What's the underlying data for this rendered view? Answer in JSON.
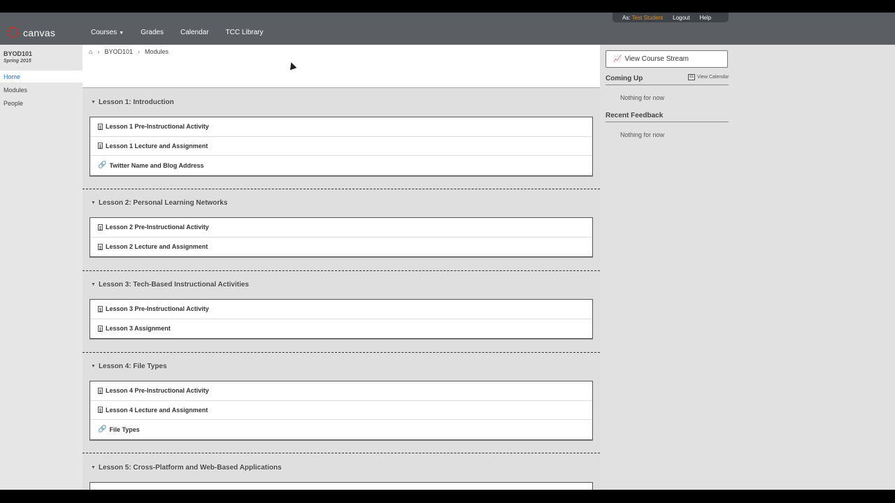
{
  "header": {
    "user_bar": {
      "as_label": "As:",
      "student": "Test Student",
      "logout": "Logout",
      "help": "Help"
    },
    "logo_text": "canvas",
    "nav": {
      "courses": "Courses",
      "grades": "Grades",
      "calendar": "Calendar",
      "library": "TCC Library"
    }
  },
  "course": {
    "id": "BYOD101",
    "term": "Spring 2015",
    "nav": [
      "Home",
      "Modules",
      "People"
    ]
  },
  "breadcrumb": {
    "course": "BYOD101",
    "page": "Modules"
  },
  "modules": [
    {
      "title": "Lesson 1: Introduction",
      "items": [
        {
          "label": "Lesson 1 Pre-Instructional Activity",
          "icon": "page-icon"
        },
        {
          "label": "Lesson 1 Lecture and Assignment",
          "icon": "page-icon"
        },
        {
          "label": "Twitter Name and Blog Address",
          "icon": "link-icon"
        }
      ]
    },
    {
      "title": "Lesson 2: Personal Learning Networks",
      "items": [
        {
          "label": "Lesson 2 Pre-Instructional Activity",
          "icon": "page-icon"
        },
        {
          "label": "Lesson 2 Lecture and Assignment",
          "icon": "page-icon"
        }
      ]
    },
    {
      "title": "Lesson 3: Tech-Based Instructional Activities",
      "items": [
        {
          "label": "Lesson 3 Pre-Instructional Activity",
          "icon": "page-icon"
        },
        {
          "label": "Lesson 3 Assignment",
          "icon": "page-icon"
        }
      ]
    },
    {
      "title": "Lesson 4: File Types",
      "items": [
        {
          "label": "Lesson 4 Pre-Instructional Activity",
          "icon": "page-icon"
        },
        {
          "label": "Lesson 4 Lecture and Assignment",
          "icon": "page-icon"
        },
        {
          "label": "File Types",
          "icon": "link-icon"
        }
      ]
    },
    {
      "title": "Lesson 5: Cross-Platform and Web-Based Applications",
      "items": []
    }
  ],
  "sidebar": {
    "stream_button": "View Course Stream",
    "coming_up": "Coming Up",
    "view_calendar": "View Calendar",
    "coming_up_empty": "Nothing for now",
    "recent_feedback": "Recent Feedback",
    "feedback_empty": "Nothing for now"
  },
  "colors": {
    "header_bg": "#5b5e62",
    "logo_red": "#c8312b",
    "student_orange": "#d8902c",
    "link_blue": "#2a6ebf"
  }
}
